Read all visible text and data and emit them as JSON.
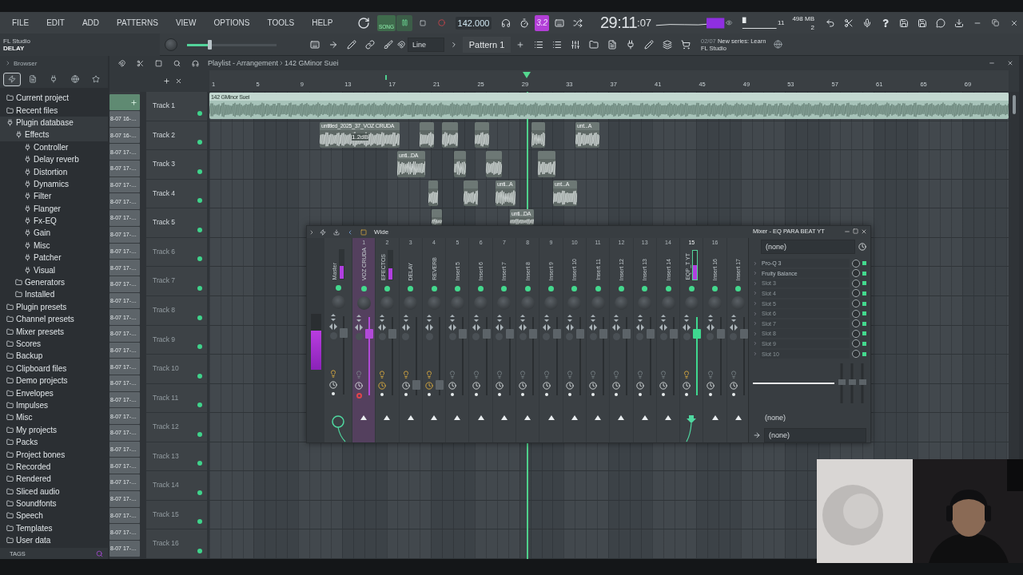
{
  "menu": [
    "FILE",
    "EDIT",
    "ADD",
    "PATTERNS",
    "VIEW",
    "OPTIONS",
    "TOOLS",
    "HELP"
  ],
  "transport": {
    "mode": "SONG",
    "playing": true,
    "recording": false,
    "tempo": "142.000",
    "badge": "3.2",
    "time": "29:11",
    "time_fraction": ":07"
  },
  "monitor": {
    "voices": "11",
    "memory": "498 MB",
    "polyphony": "2"
  },
  "hint": {
    "title": "FL Studio",
    "text": "DELAY"
  },
  "master_volume": {
    "level": 0.25
  },
  "snap": "Line",
  "pattern": "Pattern 1",
  "news": {
    "date": "02/07",
    "headline": "New series: Learn",
    "source": "FL Studio"
  },
  "browser": {
    "title": "Browser",
    "tabs": [
      {
        "kind": "all",
        "selected": true
      },
      {
        "kind": "files",
        "selected": false
      },
      {
        "kind": "plugins",
        "selected": false
      },
      {
        "kind": "web",
        "selected": false
      },
      {
        "kind": "starred",
        "selected": false
      }
    ],
    "items": [
      {
        "label": "Current project"
      },
      {
        "label": "Recent files"
      },
      {
        "label": "Plugin database",
        "expanded": true,
        "children": [
          {
            "label": "Effects",
            "expanded": true,
            "children": [
              {
                "label": "Controller"
              },
              {
                "label": "Delay reverb"
              },
              {
                "label": "Distortion"
              },
              {
                "label": "Dynamics"
              },
              {
                "label": "Filter"
              },
              {
                "label": "Flanger"
              },
              {
                "label": "Fx-EQ"
              },
              {
                "label": "Gain"
              },
              {
                "label": "Misc"
              },
              {
                "label": "Patcher"
              },
              {
                "label": "Visual"
              }
            ]
          },
          {
            "label": "Generators"
          },
          {
            "label": "Installed"
          }
        ]
      },
      {
        "label": "Plugin presets"
      },
      {
        "label": "Channel presets"
      },
      {
        "label": "Mixer presets"
      },
      {
        "label": "Scores"
      },
      {
        "label": "Backup"
      },
      {
        "label": "Clipboard files"
      },
      {
        "label": "Demo projects"
      },
      {
        "label": "Envelopes"
      },
      {
        "label": "Impulses"
      },
      {
        "label": "Misc"
      },
      {
        "label": "My projects"
      },
      {
        "label": "Packs"
      },
      {
        "label": "Project bones"
      },
      {
        "label": "Recorded"
      },
      {
        "label": "Rendered"
      },
      {
        "label": "Sliced audio"
      },
      {
        "label": "Soundfonts"
      },
      {
        "label": "Speech"
      },
      {
        "label": "Templates"
      },
      {
        "label": "User data"
      }
    ],
    "footer": "TAGS"
  },
  "pattern_clips": [
    "8-07 16-…",
    "8-07 16-…",
    "8-07 17-…",
    "8-07 17-…",
    "8-07 17-…",
    "8-07 17-…",
    "8-07 17-…",
    "8-07 17-…",
    "8-07 17-…",
    "8-07 17-…",
    "8-07 17-…",
    "8-07 17-…",
    "8-07 17-…",
    "8-07 17-…",
    "8-07 17-…",
    "8-07 17-…",
    "8-07 17-…",
    "8-07 17-…",
    "8-07 17-…",
    "8-07 17-…",
    "8-07 17-…",
    "8-07 17-…",
    "8-07 17-…",
    "8-07 17-…",
    "8-07 17-…",
    "8-07 17-…",
    "8-07 17-…"
  ],
  "playlist": {
    "title": "Playlist - Arrangement",
    "song": "142 GMinor Suei",
    "ruler": [
      "1",
      "5",
      "9",
      "13",
      "17",
      "21",
      "25",
      "29",
      "33",
      "37",
      "41",
      "45",
      "49",
      "53",
      "57",
      "61",
      "65",
      "69"
    ],
    "tracks": [
      {
        "name": "Track 1",
        "clips": [
          {
            "kind": "audio",
            "label": "142 GMinor Suei"
          }
        ]
      },
      {
        "name": "Track 2",
        "clips": [
          {
            "kind": "audio",
            "label": "untitled_2025_37_VOZ CRUDA",
            "gain": "1.2dB"
          },
          {
            "kind": "audio"
          },
          {
            "kind": "audio"
          },
          {
            "kind": "audio"
          },
          {
            "kind": "audio"
          },
          {
            "kind": "audio",
            "label": "unt...A"
          }
        ]
      },
      {
        "name": "Track 3",
        "clips": [
          {
            "kind": "audio",
            "label": "unti...DA"
          },
          {
            "kind": "audio"
          },
          {
            "kind": "audio"
          },
          {
            "kind": "audio"
          }
        ]
      },
      {
        "name": "Track 4",
        "clips": [
          {
            "kind": "audio"
          },
          {
            "kind": "audio"
          },
          {
            "kind": "audio",
            "label": "unti...A"
          },
          {
            "kind": "audio",
            "label": "unt...A"
          }
        ]
      },
      {
        "name": "Track 5",
        "clips": [
          {
            "kind": "audio"
          },
          {
            "kind": "audio",
            "label": "unti...DA"
          }
        ]
      },
      {
        "name": "Track 6"
      },
      {
        "name": "Track 7"
      },
      {
        "name": "Track 8"
      },
      {
        "name": "Track 9"
      },
      {
        "name": "Track 10"
      },
      {
        "name": "Track 11"
      },
      {
        "name": "Track 12"
      },
      {
        "name": "Track 13"
      },
      {
        "name": "Track 14"
      },
      {
        "name": "Track 15"
      },
      {
        "name": "Track 16"
      }
    ]
  },
  "mixer": {
    "view": "Wide",
    "output_meter": {
      "level": 0.7
    },
    "channels": [
      {
        "kind": "master",
        "name": "Master",
        "selected": false,
        "current": false,
        "armed": false,
        "send_on": true,
        "comp_on": false,
        "routed": true,
        "fader": {
          "level": 0.83
        },
        "meter": {
          "level": 0.45
        }
      },
      {
        "kind": "insert",
        "number": "1",
        "name": "VOZ CRUDA",
        "selected": true,
        "current": false,
        "armed": true,
        "send_on": false,
        "comp_on": false,
        "routed": false,
        "fader": {
          "level": 0.83
        }
      },
      {
        "kind": "insert",
        "number": "2",
        "name": "EFECTOS",
        "selected": false,
        "current": false,
        "armed": false,
        "send_on": true,
        "comp_on": true,
        "routed": false,
        "fader": {
          "level": 0.83
        },
        "meter": {
          "level": 0.4
        }
      },
      {
        "kind": "insert",
        "number": "3",
        "name": "DELAY",
        "selected": false,
        "current": false,
        "armed": false,
        "send_on": true,
        "comp_on": false,
        "routed": false,
        "fader": {
          "level": 0.08
        }
      },
      {
        "kind": "insert",
        "number": "4",
        "name": "REVERB",
        "selected": false,
        "current": false,
        "armed": false,
        "send_on": true,
        "comp_on": true,
        "routed": false,
        "fader": {
          "level": 0.08
        }
      },
      {
        "kind": "insert",
        "number": "5",
        "name": "Insert 5",
        "selected": false,
        "current": false,
        "armed": false,
        "send_on": false,
        "comp_on": false,
        "routed": false,
        "fader": {
          "level": 0.83
        }
      },
      {
        "kind": "insert",
        "number": "6",
        "name": "Insert 6",
        "selected": false,
        "current": false,
        "armed": false,
        "send_on": false,
        "comp_on": false,
        "routed": false,
        "fader": {
          "level": 0.83
        }
      },
      {
        "kind": "insert",
        "number": "7",
        "name": "Insert 7",
        "selected": false,
        "current": false,
        "armed": false,
        "send_on": false,
        "comp_on": false,
        "routed": false,
        "fader": {
          "level": 0.83
        }
      },
      {
        "kind": "insert",
        "number": "8",
        "name": "Insert 8",
        "selected": false,
        "current": false,
        "armed": false,
        "send_on": false,
        "comp_on": false,
        "routed": false,
        "fader": {
          "level": 0.83
        }
      },
      {
        "kind": "insert",
        "number": "9",
        "name": "Insert 9",
        "selected": false,
        "current": false,
        "armed": false,
        "send_on": false,
        "comp_on": false,
        "routed": false,
        "fader": {
          "level": 0.83
        }
      },
      {
        "kind": "insert",
        "number": "10",
        "name": "Insert 10",
        "selected": false,
        "current": false,
        "armed": false,
        "send_on": false,
        "comp_on": false,
        "routed": false,
        "fader": {
          "level": 0.83
        }
      },
      {
        "kind": "insert",
        "number": "11",
        "name": "Insert 11",
        "selected": false,
        "current": false,
        "armed": false,
        "send_on": false,
        "comp_on": false,
        "routed": false,
        "fader": {
          "level": 0.83
        }
      },
      {
        "kind": "insert",
        "number": "12",
        "name": "Insert 12",
        "selected": false,
        "current": false,
        "armed": false,
        "send_on": false,
        "comp_on": false,
        "routed": false,
        "fader": {
          "level": 0.83
        }
      },
      {
        "kind": "insert",
        "number": "13",
        "name": "Insert 13",
        "selected": false,
        "current": false,
        "armed": false,
        "send_on": false,
        "comp_on": false,
        "routed": false,
        "fader": {
          "level": 0.83
        }
      },
      {
        "kind": "insert",
        "number": "14",
        "name": "Insert 14",
        "selected": false,
        "current": false,
        "armed": false,
        "send_on": false,
        "comp_on": false,
        "routed": false,
        "fader": {
          "level": 0.83
        }
      },
      {
        "kind": "insert",
        "number": "15",
        "name": "EQP_T YT",
        "selected": false,
        "current": true,
        "armed": false,
        "send_on": true,
        "comp_on": false,
        "routed": true,
        "fader": {
          "level": 0.83
        },
        "meter": {
          "level": 0.5
        }
      },
      {
        "kind": "insert",
        "number": "16",
        "name": "Insert 16",
        "selected": false,
        "current": false,
        "armed": false,
        "send_on": false,
        "comp_on": false,
        "routed": false,
        "fader": {
          "level": 0.83
        }
      },
      {
        "kind": "insert",
        "name": "Insert 17",
        "selected": false,
        "current": false,
        "armed": false,
        "send_on": false,
        "comp_on": false,
        "routed": false,
        "fader": {
          "level": 0.83
        }
      }
    ],
    "panel": {
      "title": "Mixer - EQ PARA BEAT YT",
      "preset": "(none)",
      "slots": [
        {
          "kind": "plugin",
          "name": "Pro-Q 3",
          "enabled": true
        },
        {
          "kind": "plugin",
          "name": "Fruity Balance",
          "enabled": true
        },
        {
          "kind": "empty",
          "name": "Slot 3",
          "enabled": true
        },
        {
          "kind": "empty",
          "name": "Slot 4",
          "enabled": true
        },
        {
          "kind": "empty",
          "name": "Slot 5",
          "enabled": true
        },
        {
          "kind": "empty",
          "name": "Slot 6",
          "enabled": true
        },
        {
          "kind": "empty",
          "name": "Slot 7",
          "enabled": true
        },
        {
          "kind": "empty",
          "name": "Slot 8",
          "enabled": true
        },
        {
          "kind": "empty",
          "name": "Slot 9",
          "enabled": true
        },
        {
          "kind": "empty",
          "name": "Slot 10",
          "enabled": true
        }
      ],
      "input": "(none)",
      "output": "(none)"
    }
  }
}
